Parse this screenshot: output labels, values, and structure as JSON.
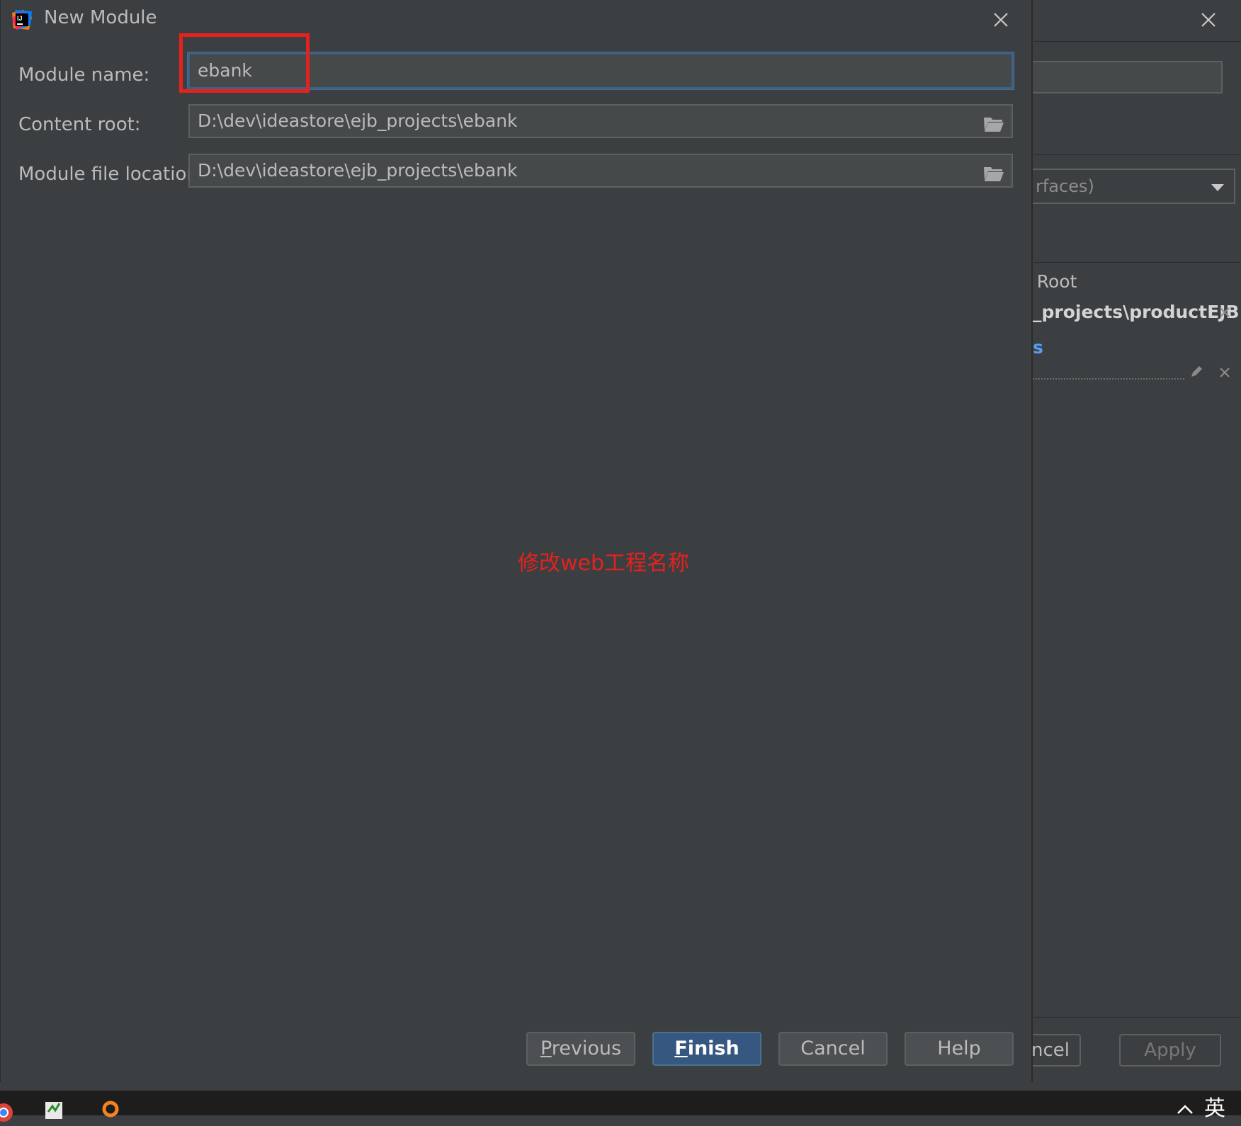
{
  "background_window": {
    "combo_text": "rfaces)",
    "section_label": "t Root",
    "path_text": "_projects\\productEJB",
    "link_text": "s",
    "cancel_label": "ancel",
    "apply_label": "Apply"
  },
  "dialog": {
    "title": "New Module",
    "fields": [
      {
        "label": "Module name:",
        "value": "ebank"
      },
      {
        "label": "Content root:",
        "value": "D:\\dev\\ideastore\\ejb_projects\\ebank"
      },
      {
        "label": "Module file location:",
        "value": "D:\\dev\\ideastore\\ejb_projects\\ebank"
      }
    ],
    "annotation": "修改web工程名称",
    "buttons": {
      "previous": "Previous",
      "finish": "Finish",
      "cancel": "Cancel",
      "help": "Help"
    }
  },
  "taskbar": {
    "ime_label": "英"
  },
  "colors": {
    "background": "#3c3f41",
    "field": "#45494a",
    "primary_button": "#365880",
    "annotation_red": "#e5211d",
    "focus_border": "#3d6185"
  }
}
